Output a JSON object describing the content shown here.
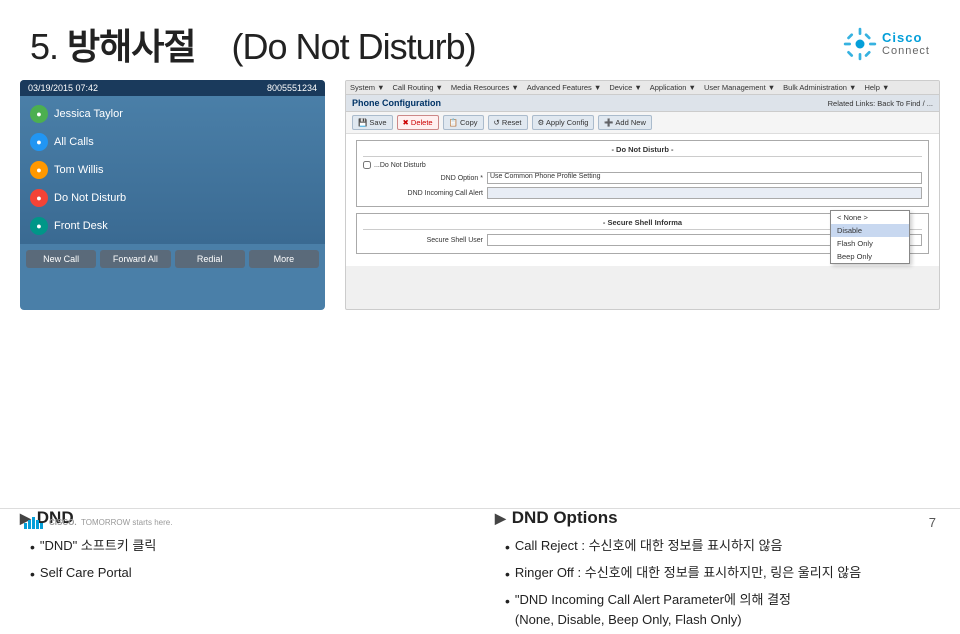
{
  "header": {
    "title_number": "5.",
    "title_korean": "방해사절",
    "title_english": "(Do Not Disturb)",
    "logo_cisco": "Cisco",
    "logo_connect": "Connect"
  },
  "phone": {
    "statusbar_time": "03/19/2015 07:42",
    "statusbar_number": "8005551234",
    "contacts": [
      {
        "name": "Jessica Taylor",
        "color": "green"
      },
      {
        "name": "All Calls",
        "color": "blue"
      },
      {
        "name": "Tom Willis",
        "color": "orange"
      },
      {
        "name": "Do Not Disturb",
        "color": "red"
      },
      {
        "name": "Front Desk",
        "color": "teal"
      }
    ],
    "buttons": [
      "New Call",
      "Forward All",
      "Redial",
      "More"
    ]
  },
  "config": {
    "menubar_items": [
      "System ▼",
      "Call Routing ▼",
      "Media Resources ▼",
      "Advanced Features ▼",
      "Device ▼",
      "Application ▼",
      "User Management ▼",
      "Bulk Administration ▼",
      "Help ▼"
    ],
    "section_title": "Phone Configuration",
    "related_links_label": "Related Links:",
    "related_links_value": "Back To Find / ...",
    "toolbar_buttons": [
      "Save",
      "Delete",
      "Copy",
      "Reset",
      "Apply Config",
      "Add New"
    ],
    "dnd_section_title": "- Do Not Disturb -",
    "checkbox_label": "...Do Not Disturb",
    "dnd_option_label": "DND Option *",
    "dnd_option_value": "Use Common Phone Profile Setting",
    "dnd_incoming_label": "DND Incoming Call Alert",
    "dropdown_options": [
      "< None >",
      "Disable",
      "Flash Only",
      "Beep Only"
    ],
    "dropdown_selected": "Disable",
    "secure_section_title": "- Secure Shell Informa",
    "secure_user_label": "Secure Shell User"
  },
  "bullets_left": {
    "heading": "DND",
    "items": [
      "\"DND\" 소프트키 클릭",
      "Self Care Portal"
    ]
  },
  "bullets_right": {
    "heading": "DND Options",
    "items": [
      "Call Reject : 수신호에 대한 정보를 표시하지 않음",
      "Ringer Off : 수신호에 대한 정보를 표시하지만, 링은 울리지 않음",
      "\"DND Incoming Call Alert Parameter에 의해 결정 (None, Disable, Beep Only, Flash Only)"
    ]
  },
  "footer": {
    "cisco_label": "CISCO.",
    "tagline": "TOMORROW starts here.",
    "page_number": "7"
  }
}
